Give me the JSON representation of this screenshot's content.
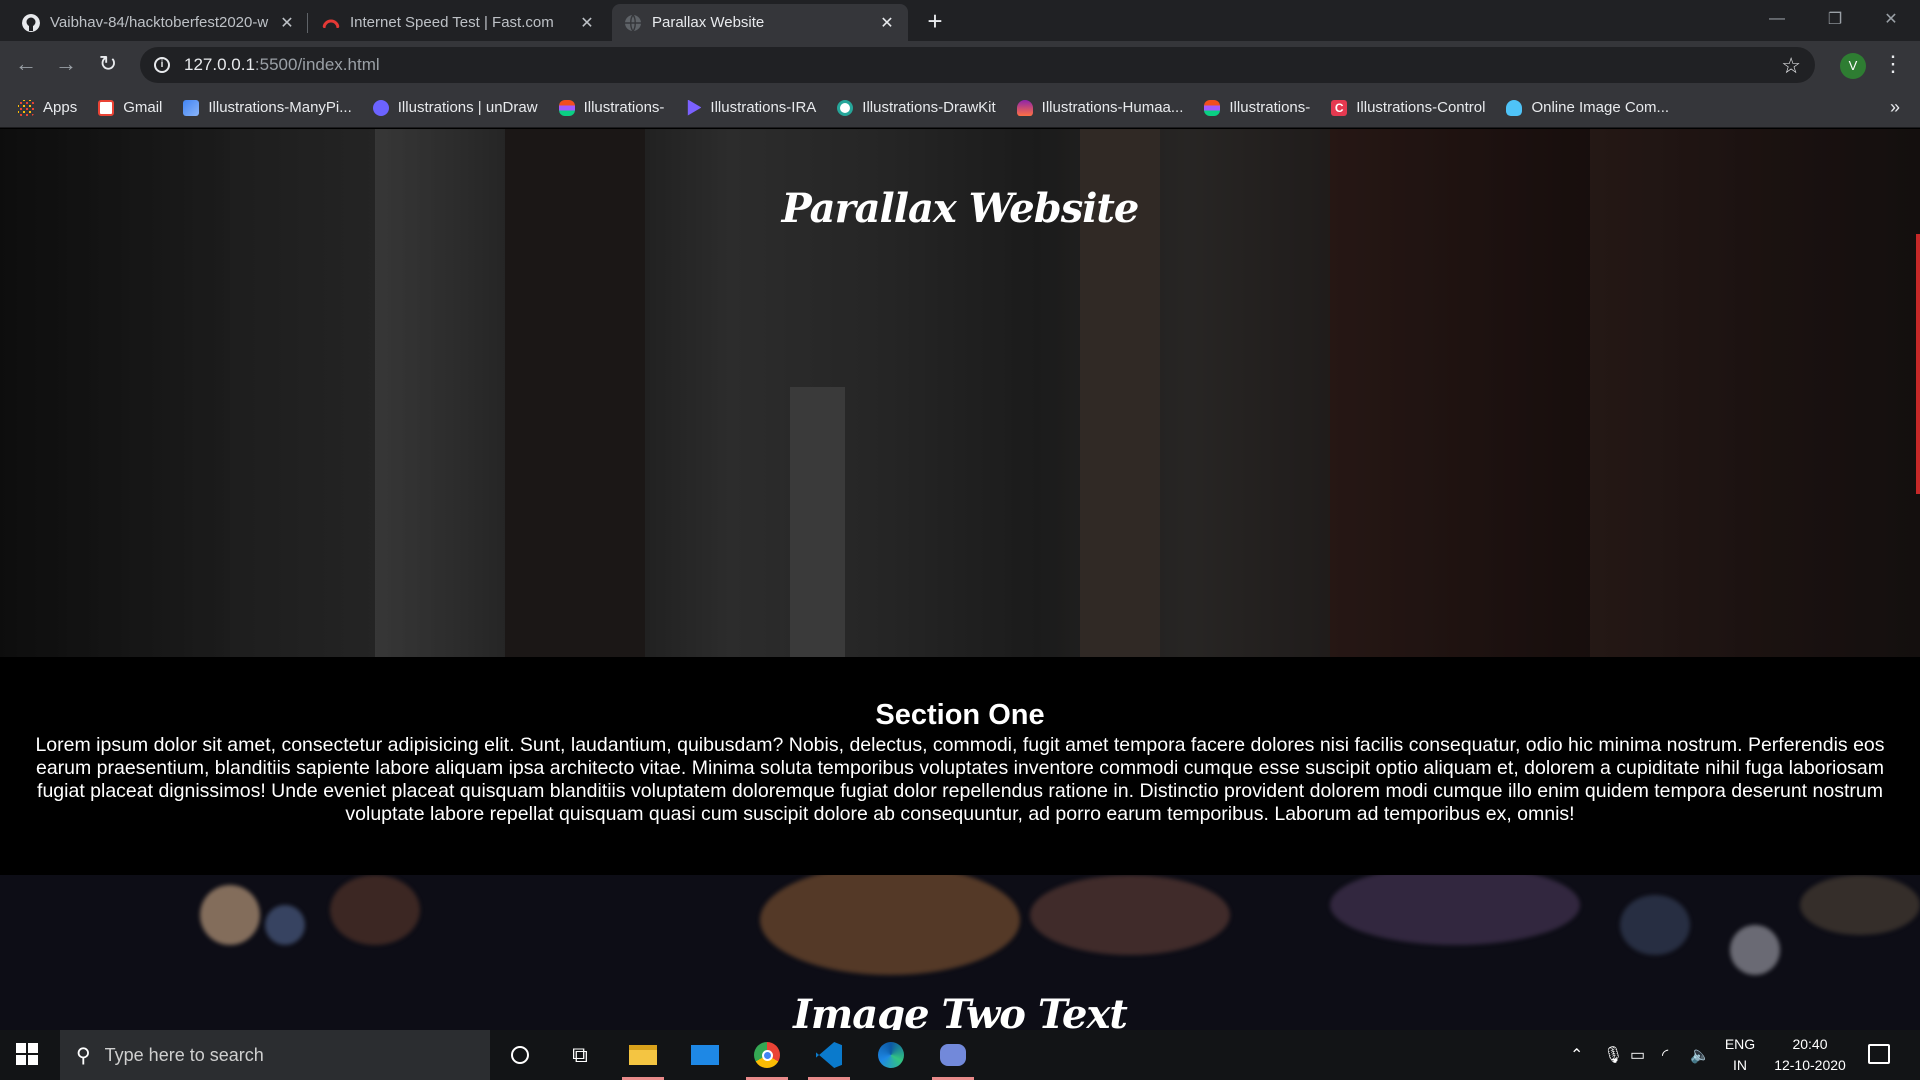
{
  "browser": {
    "tabs": [
      {
        "title": "Vaibhav-84/hacktoberfest2020-w",
        "icon": "github-icon"
      },
      {
        "title": "Internet Speed Test | Fast.com",
        "icon": "fast-icon"
      },
      {
        "title": "Parallax Website",
        "icon": "globe-icon",
        "active": true
      }
    ],
    "new_tab": "+",
    "address": {
      "host": "127.0.0.1",
      "path": ":5500/index.html"
    },
    "profile_initial": "V",
    "bookmarks": [
      {
        "label": "Apps",
        "icon": "apps-icon",
        "color": "#ea4335"
      },
      {
        "label": "Gmail",
        "icon": "gmail-icon",
        "color": "#ea4335"
      },
      {
        "label": "Illustrations-ManyPi...",
        "icon": "manypixels-icon",
        "color": "#4285f4"
      },
      {
        "label": "Illustrations | unDraw",
        "icon": "undraw-icon",
        "color": "#6c63ff"
      },
      {
        "label": "Illustrations-",
        "icon": "figma-icon",
        "color": "#a259ff"
      },
      {
        "label": "Illustrations-IRA",
        "icon": "ira-icon",
        "color": "#7b61ff"
      },
      {
        "label": "Illustrations-DrawKit",
        "icon": "drawkit-icon",
        "color": "#26a69a"
      },
      {
        "label": "Illustrations-Humaa...",
        "icon": "humaaans-icon",
        "color": "#8e24aa"
      },
      {
        "label": "Illustrations-",
        "icon": "figma-icon",
        "color": "#a259ff"
      },
      {
        "label": "Illustrations-Control",
        "icon": "control-icon",
        "color": "#e53950"
      },
      {
        "label": "Online Image Com...",
        "icon": "image-compress-icon",
        "color": "#4fc3f7"
      }
    ],
    "bookmarks_more": "»"
  },
  "page": {
    "hero_title": "Parallax Website",
    "section_one": {
      "heading": "Section One",
      "body": "Lorem ipsum dolor sit amet, consectetur adipisicing elit. Sunt, laudantium, quibusdam? Nobis, delectus, commodi, fugit amet tempora facere dolores nisi facilis consequatur, odio hic minima nostrum. Perferendis eos earum praesentium, blanditiis sapiente labore aliquam ipsa architecto vitae. Minima soluta temporibus voluptates inventore commodi cumque esse suscipit optio aliquam et, dolorem a cupiditate nihil fuga laboriosam fugiat placeat dignissimos! Unde eveniet placeat quisquam blanditiis voluptatem doloremque fugiat dolor repellendus ratione in. Distinctio provident dolorem modi cumque illo enim quidem tempora deserunt nostrum voluptate labore repellat quisquam quasi cum suscipit dolore ab consequuntur, ad porro earum temporibus. Laborum ad temporibus ex, omnis!"
    },
    "hero2_title": "Image Two Text"
  },
  "taskbar": {
    "search_placeholder": "Type here to search",
    "apps": [
      "cortana-icon",
      "task-view-icon",
      "file-explorer-icon",
      "mail-icon",
      "chrome-icon",
      "vscode-icon",
      "edge-icon",
      "discord-icon"
    ],
    "language": "ENG",
    "region": "IN",
    "time": "20:40",
    "date": "12-10-2020"
  }
}
